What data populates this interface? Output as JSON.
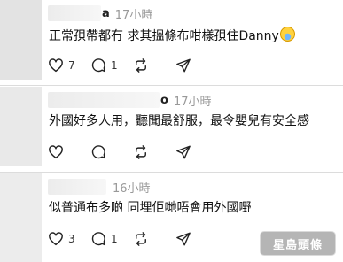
{
  "comments": [
    {
      "name_tail": "a",
      "time": "17小時",
      "text": "正常孭帶都冇 求其搵條布咁樣孭住Danny",
      "emoji": "fearful-face",
      "likes": "7",
      "replies": "1"
    },
    {
      "name_tail": "o",
      "time": "17小時",
      "text": "外國好多人用，聽聞最舒服，最令嬰兒有安全感",
      "likes": "",
      "replies": ""
    },
    {
      "name_tail": "",
      "time": "16小時",
      "text": "似普通布多啲 同埋佢哋唔會用外國嘢",
      "likes": "3",
      "replies": "1"
    }
  ],
  "icons": {
    "like": "heart-icon",
    "reply": "comment-bubble-icon",
    "repost": "repost-icon",
    "share": "share-send-icon"
  },
  "colors": {
    "time": "#999999",
    "icon": "#222222",
    "divider": "#dcdcdc"
  },
  "watermark": {
    "logo_text": "星島頭條"
  }
}
